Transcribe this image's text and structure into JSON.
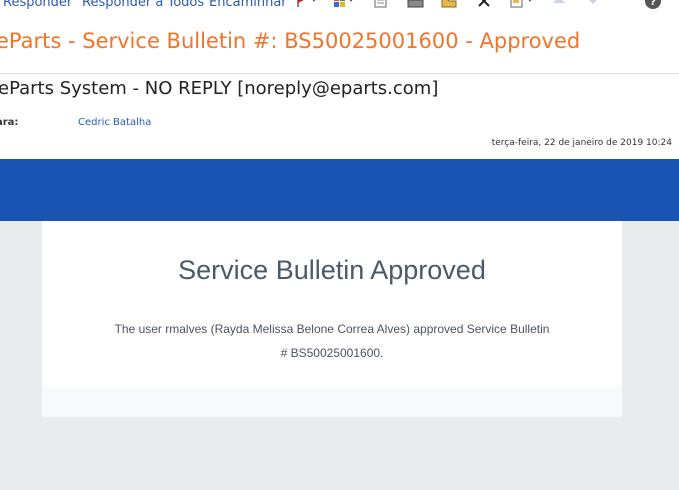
{
  "toolbar": {
    "reply_label": "Responder",
    "reply_all_label": "Responder a Todos",
    "forward_label": "Encaminhar",
    "icons": [
      "flag-icon",
      "categories-icon",
      "move-icon",
      "print-icon",
      "open-folder-icon",
      "delete-icon",
      "rules-icon",
      "previous-icon",
      "next-icon",
      "help-icon"
    ]
  },
  "message": {
    "subject": "eParts - Service Bulletin #: BS50025001600 - Approved",
    "from": "eParts System - NO REPLY [noreply@eparts.com]",
    "to_label": "ara:",
    "to_value": "Cedric Batalha",
    "date": "terça-feira, 22 de janeiro de 2019 10:24"
  },
  "email_body": {
    "title": "Service Bulletin Approved",
    "text": "The user rmalves (Rayda Melissa Belone Correa Alves) approved Service Bulletin # BS50025001600."
  },
  "colors": {
    "subject": "#f0742a",
    "link": "#2a5bb0",
    "band": "#1a55b3",
    "body_bg": "#eaebec"
  }
}
